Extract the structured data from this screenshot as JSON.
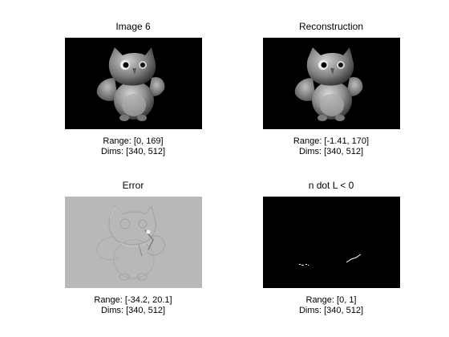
{
  "figure": {
    "panels": [
      {
        "title": "Image 6",
        "range_label": "Range: [0, 169]",
        "dims_label": "Dims: [340, 512]",
        "image_kind": "owl-photo",
        "background": "#000000"
      },
      {
        "title": "Reconstruction",
        "range_label": "Range: [-1.41, 170]",
        "dims_label": "Dims: [340, 512]",
        "image_kind": "owl-photo",
        "background": "#000000"
      },
      {
        "title": "Error",
        "range_label": "Range: [-34.2, 20.1]",
        "dims_label": "Dims: [340, 512]",
        "image_kind": "owl-error-map",
        "background": "#b8b8b8"
      },
      {
        "title": "n dot L < 0",
        "range_label": "Range: [0, 1]",
        "dims_label": "Dims: [340, 512]",
        "image_kind": "binary-mask",
        "background": "#000000"
      }
    ]
  }
}
